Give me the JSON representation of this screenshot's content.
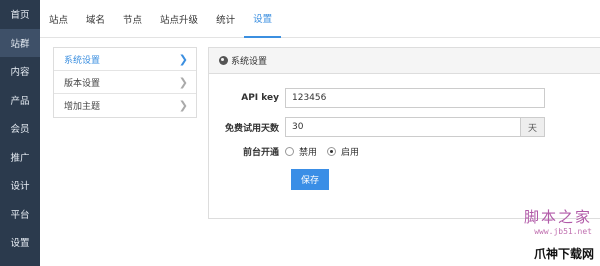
{
  "left_nav": {
    "items": [
      {
        "label": "首页"
      },
      {
        "label": "站群"
      },
      {
        "label": "内容"
      },
      {
        "label": "产品"
      },
      {
        "label": "会员"
      },
      {
        "label": "推广"
      },
      {
        "label": "设计"
      },
      {
        "label": "平台"
      },
      {
        "label": "设置"
      }
    ],
    "active_index": 1
  },
  "top_tabs": {
    "items": [
      {
        "label": "站点"
      },
      {
        "label": "域名"
      },
      {
        "label": "节点"
      },
      {
        "label": "站点升级"
      },
      {
        "label": "统计"
      },
      {
        "label": "设置"
      }
    ],
    "active_index": 5
  },
  "sub_menu": {
    "items": [
      {
        "label": "系统设置"
      },
      {
        "label": "版本设置"
      },
      {
        "label": "增加主题"
      }
    ],
    "active_index": 0
  },
  "panel": {
    "title": "系统设置",
    "fields": {
      "api_key_label": "API key",
      "api_key_value": "123456",
      "trial_days_label": "免费试用天数",
      "trial_days_value": "30",
      "trial_days_unit": "天",
      "frontend_label": "前台开通",
      "option_disable": "禁用",
      "option_enable": "启用",
      "selected": "启用"
    },
    "save_label": "保存"
  },
  "watermark": {
    "line1": "脚本之家",
    "line2": "www.jb51.net",
    "corner": "爪神下载网"
  },
  "colors": {
    "nav_bg": "#2b3a4d",
    "accent": "#3b8fe0",
    "button": "#3a8ee6"
  }
}
